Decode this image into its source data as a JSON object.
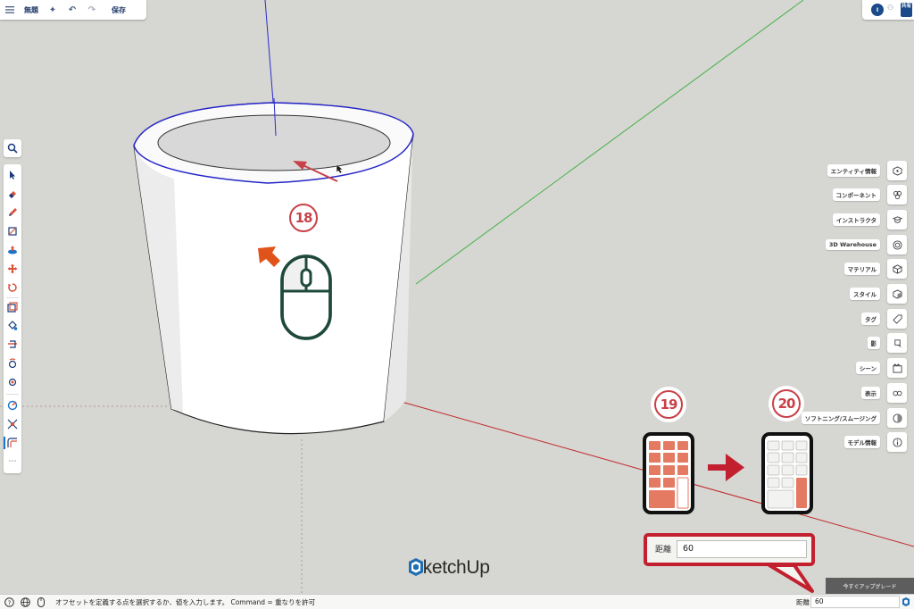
{
  "app": {
    "name": "SketchUp",
    "document_title": "無題",
    "save_label": "保存",
    "share_label": "共有",
    "avatar_initial": "Ⅱ"
  },
  "toolbar_top": {
    "icons": [
      "menu-icon",
      "sparkle-icon",
      "undo-icon",
      "redo-icon"
    ]
  },
  "left_tools": [
    {
      "name": "select-tool",
      "icon": "arrow-icon"
    },
    {
      "name": "eraser-tool",
      "icon": "eraser-icon"
    },
    {
      "name": "pencil-tool",
      "icon": "pencil-icon"
    },
    {
      "name": "rectangle-tool",
      "icon": "rectangle-icon"
    },
    {
      "name": "push-pull-tool",
      "icon": "push-pull-icon"
    },
    {
      "name": "move-tool",
      "icon": "move-icon"
    },
    {
      "name": "rotate-tool",
      "icon": "rotate-icon"
    },
    {
      "name": "scale-tool",
      "icon": "scale-icon"
    },
    {
      "name": "paint-tool",
      "icon": "paint-bucket-icon"
    },
    {
      "name": "section-plane-tool",
      "icon": "section-icon"
    },
    {
      "name": "orbit-tool",
      "icon": "orbit-icon"
    },
    {
      "name": "position-camera-tool",
      "icon": "camera-icon"
    },
    {
      "name": "tape-measure-tool",
      "icon": "tape-icon"
    },
    {
      "name": "arc-tool",
      "icon": "arc-icon"
    },
    {
      "name": "offset-tool",
      "icon": "offset-icon",
      "active": true
    }
  ],
  "more_tools": "⋯",
  "right_panels": [
    {
      "label": "エンティティ情報",
      "icon": "cube-info-icon"
    },
    {
      "label": "コンポーネント",
      "icon": "components-icon"
    },
    {
      "label": "インストラクタ",
      "icon": "graduation-cap-icon"
    },
    {
      "label": "3D Warehouse",
      "icon": "warehouse-icon"
    },
    {
      "label": "マテリアル",
      "icon": "material-cube-icon"
    },
    {
      "label": "スタイル",
      "icon": "style-cube-icon"
    },
    {
      "label": "タグ",
      "icon": "tag-icon"
    },
    {
      "label": "影",
      "icon": "shadow-icon"
    },
    {
      "label": "シーン",
      "icon": "scene-icon"
    },
    {
      "label": "表示",
      "icon": "glasses-icon"
    },
    {
      "label": "ソフトニング/スムージング",
      "icon": "half-circle-icon"
    },
    {
      "label": "モデル情報",
      "icon": "info-icon"
    }
  ],
  "annotations": {
    "badge_18": "18",
    "badge_19": "19",
    "badge_20": "20"
  },
  "callout": {
    "label": "距離",
    "value": "60"
  },
  "upgrade_label": "今すぐアップグレード",
  "statusbar": {
    "message": "オフセットを定義する点を選択するか、値を入力します。 Command = 重なりを許可",
    "vcb_label": "距離",
    "vcb_value": "60"
  },
  "colors": {
    "accent_red": "#c2202e",
    "keypad_fill": "#e57a62",
    "mouse_outline": "#1f4a3a",
    "arrow_orange": "#e0541c",
    "axis_blue": "#2222cc",
    "axis_green": "#3aa83a",
    "axis_red": "#c02828"
  }
}
